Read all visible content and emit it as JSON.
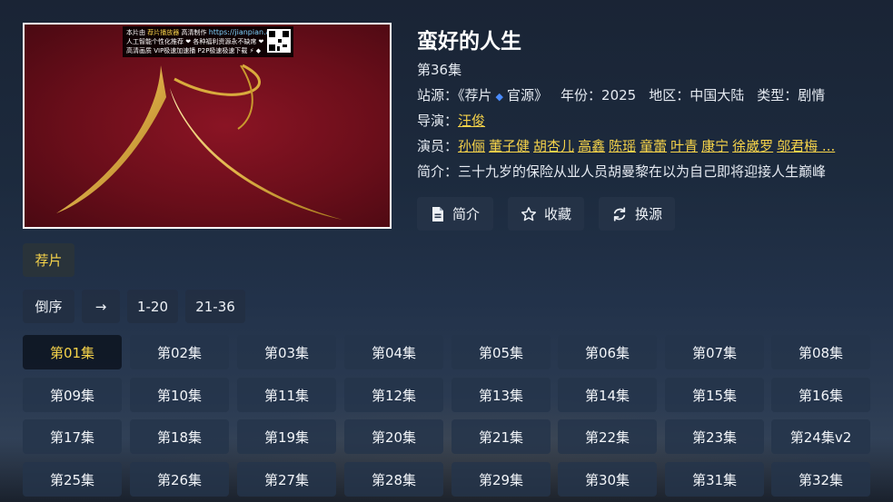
{
  "player": {
    "banner_line1_a": "本片由",
    "banner_line1_b": "荐片播放器",
    "banner_line1_c": "高清制作",
    "banner_url": "https://jianpian.app",
    "banner_line2": "人工智能个性化推荐 ❤ 各种福利资源永不缺席 ❤",
    "banner_line3": "高清画质  VIP极速加速播  P2P极速极速下载 ⚡ ◆"
  },
  "detail": {
    "title": "蛮好的人生",
    "episode_status": "第36集",
    "source_label": "站源：",
    "source_value_a": "《荐片",
    "source_value_b": "官源》",
    "year_label": "年份：",
    "year_value": "2025",
    "region_label": "地区：",
    "region_value": "中国大陆",
    "genre_label": "类型：",
    "genre_value": "剧情",
    "director_label": "导演：",
    "director": "汪俊",
    "cast_label": "演员：",
    "cast": [
      "孙俪",
      "董子健",
      "胡杏儿",
      "高鑫",
      "陈瑶",
      "童蕾",
      "叶青",
      "康宁",
      "徐崴罗",
      "邬君梅 ..."
    ],
    "synopsis_label": "简介：",
    "synopsis": "三十九岁的保险从业人员胡曼黎在以为自己即将迎接人生巅峰"
  },
  "actions": {
    "intro": "简介",
    "favorite": "收藏",
    "switch_source": "换源"
  },
  "source_tab": "荐片",
  "controls": {
    "reverse": "倒序",
    "arrow": "→",
    "range1": "1-20",
    "range2": "21-36"
  },
  "episodes": [
    "第01集",
    "第02集",
    "第03集",
    "第04集",
    "第05集",
    "第06集",
    "第07集",
    "第08集",
    "第09集",
    "第10集",
    "第11集",
    "第12集",
    "第13集",
    "第14集",
    "第15集",
    "第16集",
    "第17集",
    "第18集",
    "第19集",
    "第20集",
    "第21集",
    "第22集",
    "第23集",
    "第24集v2",
    "第25集",
    "第26集",
    "第27集",
    "第28集",
    "第29集",
    "第30集",
    "第31集",
    "第32集"
  ],
  "colors": {
    "accent": "#f6d34a",
    "link_diamond": "#4a8cff"
  },
  "icons": {
    "intro": "document-icon",
    "favorite": "star-icon",
    "switch_source": "refresh-icon"
  }
}
